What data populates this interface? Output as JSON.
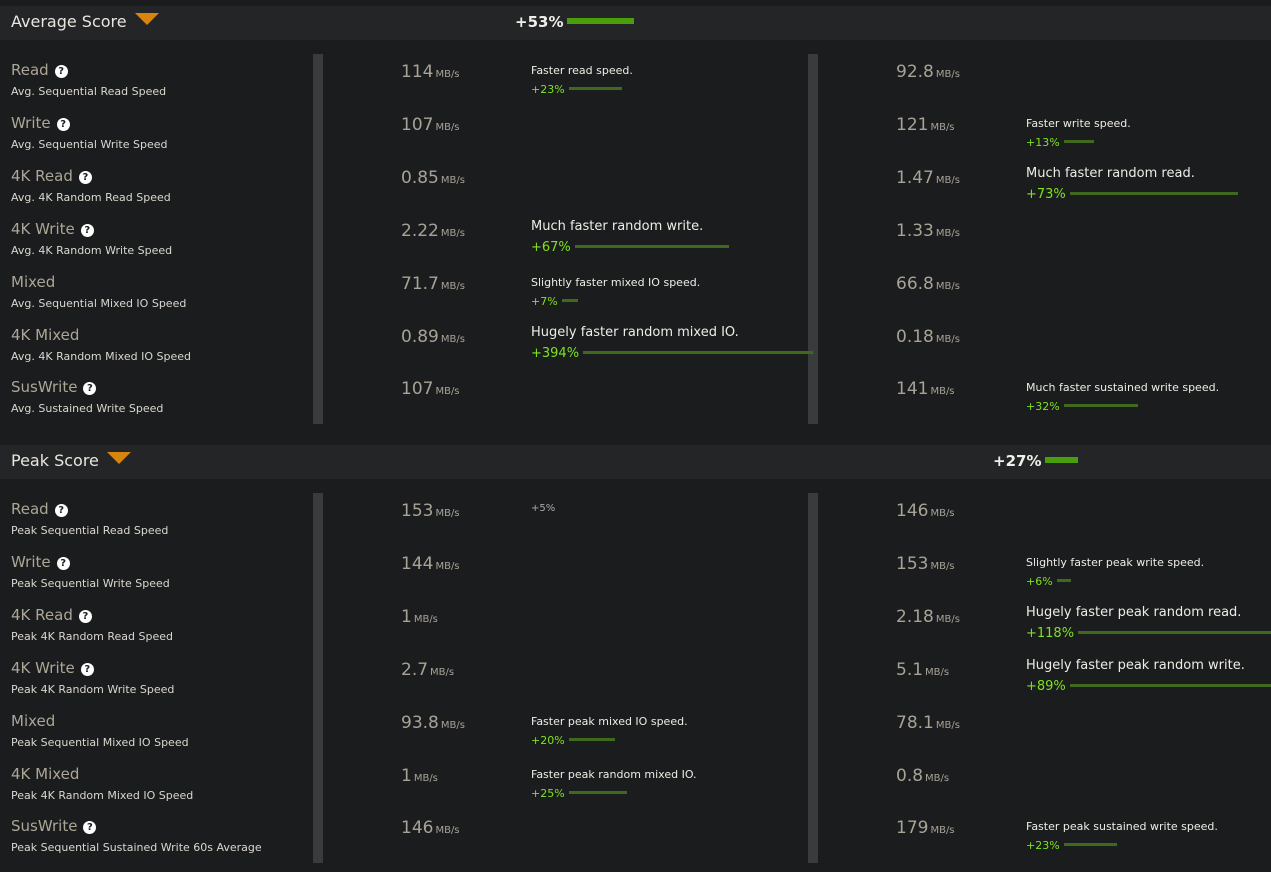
{
  "average": {
    "title": "Average Score",
    "delta": "+53%",
    "rows": [
      {
        "name": "Read",
        "desc": "Avg. Sequential Read Speed",
        "left": {
          "value": "114",
          "unit": "MB/s"
        },
        "left_cmp": {
          "text": "Faster read speed.",
          "pct": "+23%",
          "frac": 0.23
        },
        "right": {
          "value": "92.8",
          "unit": "MB/s"
        },
        "right_cmp": null
      },
      {
        "name": "Write",
        "desc": "Avg. Sequential Write Speed",
        "left": {
          "value": "107",
          "unit": "MB/s"
        },
        "left_cmp": null,
        "right": {
          "value": "121",
          "unit": "MB/s"
        },
        "right_cmp": {
          "text": "Faster write speed.",
          "pct": "+13%",
          "frac": 0.13
        }
      },
      {
        "name": "4K Read",
        "desc": "Avg. 4K Random Read Speed",
        "left": {
          "value": "0.85",
          "unit": "MB/s"
        },
        "left_cmp": null,
        "right": {
          "value": "1.47",
          "unit": "MB/s"
        },
        "right_cmp": {
          "text": "Much faster random read.",
          "pct": "+73%",
          "frac": 0.73
        }
      },
      {
        "name": "4K Write",
        "desc": "Avg. 4K Random Write Speed",
        "left": {
          "value": "2.22",
          "unit": "MB/s"
        },
        "left_cmp": {
          "text": "Much faster random write.",
          "pct": "+67%",
          "frac": 0.67
        },
        "right": {
          "value": "1.33",
          "unit": "MB/s"
        },
        "right_cmp": null
      },
      {
        "name": "Mixed",
        "desc": "Avg. Sequential Mixed IO Speed",
        "left": {
          "value": "71.7",
          "unit": "MB/s"
        },
        "left_cmp": {
          "text": "Slightly faster mixed IO speed.",
          "pct": "+7%",
          "frac": 0.07
        },
        "right": {
          "value": "66.8",
          "unit": "MB/s"
        },
        "right_cmp": null
      },
      {
        "name": "4K Mixed",
        "desc": "Avg. 4K Random Mixed IO Speed",
        "left": {
          "value": "0.89",
          "unit": "MB/s"
        },
        "left_cmp": {
          "text": "Hugely faster random mixed IO.",
          "pct": "+394%",
          "frac": 1.0
        },
        "right": {
          "value": "0.18",
          "unit": "MB/s"
        },
        "right_cmp": null
      },
      {
        "name": "SusWrite",
        "desc": "Avg. Sustained Write Speed",
        "left": {
          "value": "107",
          "unit": "MB/s"
        },
        "left_cmp": null,
        "right": {
          "value": "141",
          "unit": "MB/s"
        },
        "right_cmp": {
          "text": "Much faster sustained write speed.",
          "pct": "+32%",
          "frac": 0.32
        }
      }
    ],
    "help_rows": [
      0,
      1,
      2,
      3,
      6
    ]
  },
  "peak": {
    "title": "Peak Score",
    "delta": "+27%",
    "rows": [
      {
        "name": "Read",
        "desc": "Peak Sequential Read Speed",
        "left": {
          "value": "153",
          "unit": "MB/s"
        },
        "left_cmp": {
          "text": "",
          "pct": "+5%",
          "frac": 0
        },
        "right": {
          "value": "146",
          "unit": "MB/s"
        },
        "right_cmp": null
      },
      {
        "name": "Write",
        "desc": "Peak Sequential Write Speed",
        "left": {
          "value": "144",
          "unit": "MB/s"
        },
        "left_cmp": null,
        "right": {
          "value": "153",
          "unit": "MB/s"
        },
        "right_cmp": {
          "text": "Slightly faster peak write speed.",
          "pct": "+6%",
          "frac": 0.06
        }
      },
      {
        "name": "4K Read",
        "desc": "Peak 4K Random Read Speed",
        "left": {
          "value": "1",
          "unit": "MB/s"
        },
        "left_cmp": null,
        "right": {
          "value": "2.18",
          "unit": "MB/s"
        },
        "right_cmp": {
          "text": "Hugely faster peak random read.",
          "pct": "+118%",
          "frac": 1.0
        }
      },
      {
        "name": "4K Write",
        "desc": "Peak 4K Random Write Speed",
        "left": {
          "value": "2.7",
          "unit": "MB/s"
        },
        "left_cmp": null,
        "right": {
          "value": "5.1",
          "unit": "MB/s"
        },
        "right_cmp": {
          "text": "Hugely faster peak random write.",
          "pct": "+89%",
          "frac": 0.89
        }
      },
      {
        "name": "Mixed",
        "desc": "Peak Sequential Mixed IO Speed",
        "left": {
          "value": "93.8",
          "unit": "MB/s"
        },
        "left_cmp": {
          "text": "Faster peak mixed IO speed.",
          "pct": "+20%",
          "frac": 0.2
        },
        "right": {
          "value": "78.1",
          "unit": "MB/s"
        },
        "right_cmp": null
      },
      {
        "name": "4K Mixed",
        "desc": "Peak 4K Random Mixed IO Speed",
        "left": {
          "value": "1",
          "unit": "MB/s"
        },
        "left_cmp": {
          "text": "Faster peak random mixed IO.",
          "pct": "+25%",
          "frac": 0.25
        },
        "right": {
          "value": "0.8",
          "unit": "MB/s"
        },
        "right_cmp": null
      },
      {
        "name": "SusWrite",
        "desc": "Peak Sequential Sustained Write 60s Average",
        "left": {
          "value": "146",
          "unit": "MB/s"
        },
        "left_cmp": null,
        "right": {
          "value": "179",
          "unit": "MB/s"
        },
        "right_cmp": {
          "text": "Faster peak sustained write speed.",
          "pct": "+23%",
          "frac": 0.23
        }
      }
    ],
    "help_rows": [
      0,
      1,
      2,
      3,
      6
    ]
  },
  "colors": {
    "accent_orange": "#d9840c",
    "bar_green": "#4a9e0c",
    "pct_green": "#7ee21f"
  }
}
